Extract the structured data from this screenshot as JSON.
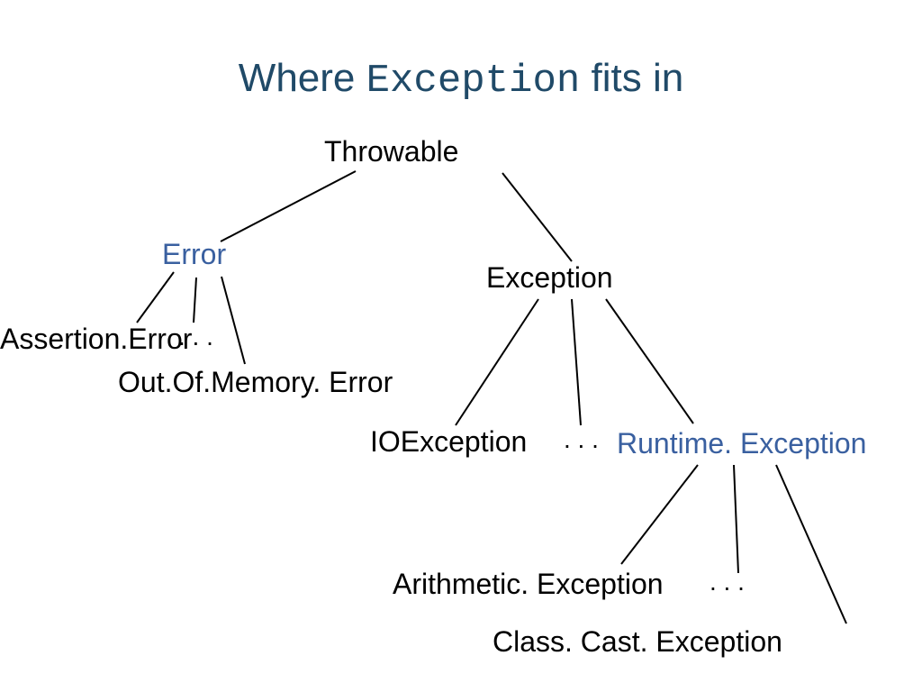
{
  "title": {
    "part1": "Where ",
    "part2": "Exception",
    "part3": " fits in"
  },
  "nodes": {
    "throwable": "Throwable",
    "error": "Error",
    "exception": "Exception",
    "assertion_error": "Assertion.Error",
    "error_dots": ". . .",
    "outofmemory": "Out.Of.Memory. Error",
    "ioexception": "IOException",
    "exc_dots": ". . .",
    "runtime": "Runtime. Exception",
    "arithmetic": "Arithmetic. Exception",
    "rt_dots": ". . .",
    "classcast": "Class. Cast. Exception"
  },
  "chart_data": {
    "type": "tree",
    "title": "Where Exception fits in",
    "root": {
      "name": "Throwable",
      "children": [
        {
          "name": "Error",
          "highlight": true,
          "children": [
            {
              "name": "AssertionError"
            },
            {
              "name": "..."
            },
            {
              "name": "OutOfMemoryError"
            }
          ]
        },
        {
          "name": "Exception",
          "children": [
            {
              "name": "IOException"
            },
            {
              "name": "..."
            },
            {
              "name": "RuntimeException",
              "highlight": true,
              "children": [
                {
                  "name": "ArithmeticException"
                },
                {
                  "name": "..."
                },
                {
                  "name": "ClassCastException"
                }
              ]
            }
          ]
        }
      ]
    }
  }
}
